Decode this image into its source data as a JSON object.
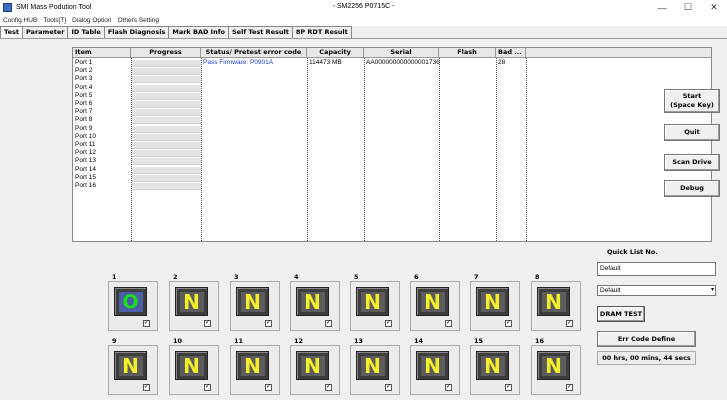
{
  "window": {
    "title": "SMI Mass Podution Tool",
    "subtitle": "- SM2256 P0715C -",
    "minimize": "—",
    "maximize": "☐",
    "close": "✕"
  },
  "menu": [
    "Config HUB",
    "Tools[T]",
    "Dialog Option",
    "Others Setting"
  ],
  "tabs": [
    "Test",
    "Parameter",
    "ID Table",
    "Flash Diagnosis",
    "Mark BAD Info",
    "Self Test Result",
    "8P RDT Result"
  ],
  "active_tab": "Test",
  "grid": {
    "headers": [
      "Item",
      "Progress",
      "Status/ Pretest error code",
      "Capacity",
      "Serial",
      "Flash",
      "Bad ..."
    ],
    "rows": [
      {
        "item": "Port 1",
        "status": "Pass    Firmware: P0901A",
        "capacity": "114473 MB",
        "serial": "AA000000000000001736",
        "flash": "",
        "bad": "28"
      },
      {
        "item": "Port 2",
        "status": "",
        "capacity": "",
        "serial": "",
        "flash": "",
        "bad": ""
      },
      {
        "item": "Port 3",
        "status": "",
        "capacity": "",
        "serial": "",
        "flash": "",
        "bad": ""
      },
      {
        "item": "Port 4",
        "status": "",
        "capacity": "",
        "serial": "",
        "flash": "",
        "bad": ""
      },
      {
        "item": "Port 5",
        "status": "",
        "capacity": "",
        "serial": "",
        "flash": "",
        "bad": ""
      },
      {
        "item": "Port 6",
        "status": "",
        "capacity": "",
        "serial": "",
        "flash": "",
        "bad": ""
      },
      {
        "item": "Port 7",
        "status": "",
        "capacity": "",
        "serial": "",
        "flash": "",
        "bad": ""
      },
      {
        "item": "Port 8",
        "status": "",
        "capacity": "",
        "serial": "",
        "flash": "",
        "bad": ""
      },
      {
        "item": "Port 9",
        "status": "",
        "capacity": "",
        "serial": "",
        "flash": "",
        "bad": ""
      },
      {
        "item": "Port 10",
        "status": "",
        "capacity": "",
        "serial": "",
        "flash": "",
        "bad": ""
      },
      {
        "item": "Port 11",
        "status": "",
        "capacity": "",
        "serial": "",
        "flash": "",
        "bad": ""
      },
      {
        "item": "Port 12",
        "status": "",
        "capacity": "",
        "serial": "",
        "flash": "",
        "bad": ""
      },
      {
        "item": "Port 13",
        "status": "",
        "capacity": "",
        "serial": "",
        "flash": "",
        "bad": ""
      },
      {
        "item": "Port 14",
        "status": "",
        "capacity": "",
        "serial": "",
        "flash": "",
        "bad": ""
      },
      {
        "item": "Port 15",
        "status": "",
        "capacity": "",
        "serial": "",
        "flash": "",
        "bad": ""
      },
      {
        "item": "Port 16",
        "status": "",
        "capacity": "",
        "serial": "",
        "flash": "",
        "bad": ""
      }
    ]
  },
  "buttons": {
    "start_line1": "Start",
    "start_line2": "(Space Key)",
    "quit": "Quit",
    "scan_drive": "Scan Drive",
    "debug": "Debug",
    "dram_test": "DRAM TEST",
    "err_code_define": "Err Code Define"
  },
  "slots": [
    {
      "num": "1",
      "glyph": "O",
      "state": "pass",
      "checked": true
    },
    {
      "num": "2",
      "glyph": "N",
      "state": "none",
      "checked": true
    },
    {
      "num": "3",
      "glyph": "N",
      "state": "none",
      "checked": true
    },
    {
      "num": "4",
      "glyph": "N",
      "state": "none",
      "checked": true
    },
    {
      "num": "5",
      "glyph": "N",
      "state": "none",
      "checked": true
    },
    {
      "num": "6",
      "glyph": "N",
      "state": "none",
      "checked": true
    },
    {
      "num": "7",
      "glyph": "N",
      "state": "none",
      "checked": true
    },
    {
      "num": "8",
      "glyph": "N",
      "state": "none",
      "checked": true
    },
    {
      "num": "9",
      "glyph": "N",
      "state": "none",
      "checked": true
    },
    {
      "num": "10",
      "glyph": "N",
      "state": "none",
      "checked": true
    },
    {
      "num": "11",
      "glyph": "N",
      "state": "none",
      "checked": true
    },
    {
      "num": "12",
      "glyph": "N",
      "state": "none",
      "checked": true
    },
    {
      "num": "13",
      "glyph": "N",
      "state": "none",
      "checked": true
    },
    {
      "num": "14",
      "glyph": "N",
      "state": "none",
      "checked": true
    },
    {
      "num": "15",
      "glyph": "N",
      "state": "none",
      "checked": true
    },
    {
      "num": "16",
      "glyph": "N",
      "state": "none",
      "checked": true
    }
  ],
  "checkmark": "✓",
  "quick_list": {
    "title": "Quick List No.",
    "input_value": "Default",
    "select_value": "Default",
    "select_arrow": "▾"
  },
  "timer": "00 hrs, 00 mins, 44 secs",
  "colors": {
    "status_text": "#1a3dd6",
    "not_ready_glyph": "#f2ee2c",
    "ready_glyph": "#18e018"
  }
}
